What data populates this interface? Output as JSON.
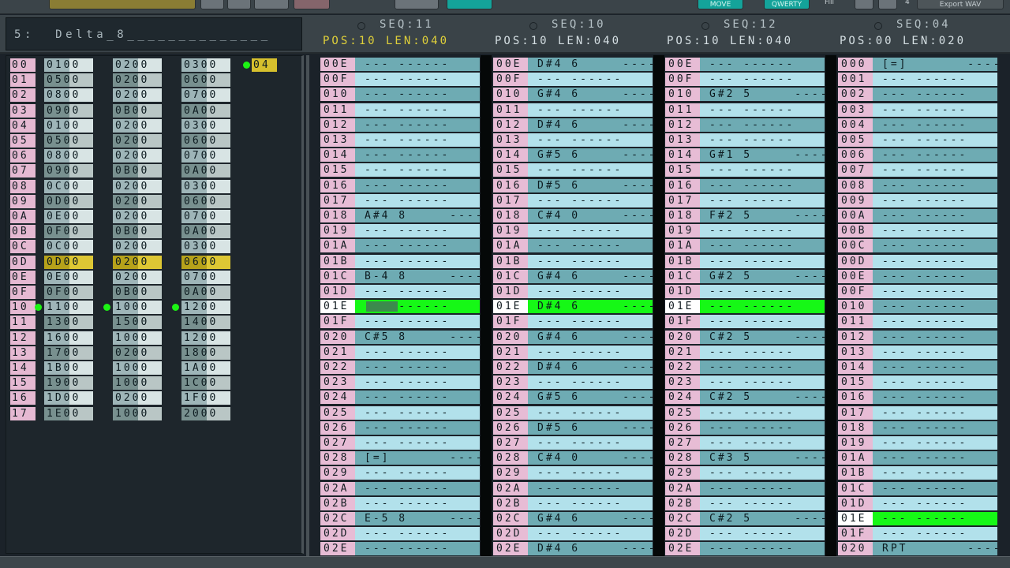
{
  "topbar": {
    "move_label": "MOVE",
    "qwerty_label": "QWERTY",
    "fill_label": "Fill",
    "fill_value": "4",
    "export_label": "Export WAV"
  },
  "song": {
    "slot": "5",
    "name": "Delta_8______________"
  },
  "sequences": [
    {
      "title": "SEQ:11",
      "pos": "10",
      "len": "040",
      "active": true
    },
    {
      "title": "SEQ:10",
      "pos": "10",
      "len": "040",
      "active": false
    },
    {
      "title": "SEQ:12",
      "pos": "10",
      "len": "040",
      "active": false
    },
    {
      "title": "SEQ:04",
      "pos": "00",
      "len": "020",
      "active": false
    }
  ],
  "colors": {
    "accent_yellow": "#dfd03a",
    "cursor_green": "#16f816",
    "row_light": "#b2e1eb",
    "row_dark": "#6eabb3",
    "row_index": "#e7bcd5"
  },
  "order_list": {
    "rows": [
      {
        "idx": "00",
        "c1": "0100",
        "c2": "0200",
        "c3": "0300"
      },
      {
        "idx": "01",
        "c1": "0500",
        "c2": "0200",
        "c3": "0600"
      },
      {
        "idx": "02",
        "c1": "0800",
        "c2": "0200",
        "c3": "0700"
      },
      {
        "idx": "03",
        "c1": "0900",
        "c2": "0B00",
        "c3": "0A00"
      },
      {
        "idx": "04",
        "c1": "0100",
        "c2": "0200",
        "c3": "0300"
      },
      {
        "idx": "05",
        "c1": "0500",
        "c2": "0200",
        "c3": "0600"
      },
      {
        "idx": "06",
        "c1": "0800",
        "c2": "0200",
        "c3": "0700"
      },
      {
        "idx": "07",
        "c1": "0900",
        "c2": "0B00",
        "c3": "0A00"
      },
      {
        "idx": "08",
        "c1": "0C00",
        "c2": "0200",
        "c3": "0300"
      },
      {
        "idx": "09",
        "c1": "0D00",
        "c2": "0200",
        "c3": "0600"
      },
      {
        "idx": "0A",
        "c1": "0E00",
        "c2": "0200",
        "c3": "0700"
      },
      {
        "idx": "0B",
        "c1": "0F00",
        "c2": "0B00",
        "c3": "0A00"
      },
      {
        "idx": "0C",
        "c1": "0C00",
        "c2": "0200",
        "c3": "0300"
      },
      {
        "idx": "0D",
        "c1": "0D00",
        "c2": "0200",
        "c3": "0600"
      },
      {
        "idx": "0E",
        "c1": "0E00",
        "c2": "0200",
        "c3": "0700"
      },
      {
        "idx": "0F",
        "c1": "0F00",
        "c2": "0B00",
        "c3": "0A00"
      },
      {
        "idx": "10",
        "c1": "1100",
        "c2": "1000",
        "c3": "1200"
      },
      {
        "idx": "11",
        "c1": "1300",
        "c2": "1500",
        "c3": "1400"
      },
      {
        "idx": "12",
        "c1": "1600",
        "c2": "1000",
        "c3": "1200"
      },
      {
        "idx": "13",
        "c1": "1700",
        "c2": "0200",
        "c3": "1800"
      },
      {
        "idx": "14",
        "c1": "1B00",
        "c2": "1000",
        "c3": "1A00"
      },
      {
        "idx": "15",
        "c1": "1900",
        "c2": "1000",
        "c3": "1C00"
      },
      {
        "idx": "16",
        "c1": "1D00",
        "c2": "0200",
        "c3": "1F00"
      },
      {
        "idx": "17",
        "c1": "1E00",
        "c2": "1000",
        "c3": "2000"
      }
    ],
    "highlight_row": "0D",
    "playing_row": "10",
    "extra_value": "04"
  },
  "tracks": [
    {
      "rows": [
        "00E",
        "00F",
        "010",
        "011",
        "012",
        "013",
        "014",
        "015",
        "016",
        "017",
        "018",
        "019",
        "01A",
        "01B",
        "01C",
        "01D",
        "01E",
        "01F",
        "020",
        "021",
        "022",
        "023",
        "024",
        "025",
        "026",
        "027",
        "028",
        "029",
        "02A",
        "02B",
        "02C",
        "02D",
        "02E"
      ],
      "notes": {
        "018": "A#4 8",
        "01C": "B-4 8",
        "020": "C#5 8",
        "028": "[=]",
        "02C": "E-5 8"
      }
    },
    {
      "rows": [
        "00E",
        "00F",
        "010",
        "011",
        "012",
        "013",
        "014",
        "015",
        "016",
        "017",
        "018",
        "019",
        "01A",
        "01B",
        "01C",
        "01D",
        "01E",
        "01F",
        "020",
        "021",
        "022",
        "023",
        "024",
        "025",
        "026",
        "027",
        "028",
        "029",
        "02A",
        "02B",
        "02C",
        "02D",
        "02E"
      ],
      "notes": {
        "00E": "D#4 6",
        "010": "G#4 6",
        "012": "D#4 6",
        "014": "G#5 6",
        "016": "D#5 6",
        "018": "C#4 0",
        "01C": "G#4 6",
        "01E": "D#4 6",
        "020": "G#4 6",
        "022": "D#4 6",
        "024": "G#5 6",
        "026": "D#5 6",
        "028": "C#4 0",
        "02C": "G#4 6",
        "02E": "D#4 6"
      }
    },
    {
      "rows": [
        "00E",
        "00F",
        "010",
        "011",
        "012",
        "013",
        "014",
        "015",
        "016",
        "017",
        "018",
        "019",
        "01A",
        "01B",
        "01C",
        "01D",
        "01E",
        "01F",
        "020",
        "021",
        "022",
        "023",
        "024",
        "025",
        "026",
        "027",
        "028",
        "029",
        "02A",
        "02B",
        "02C",
        "02D",
        "02E"
      ],
      "notes": {
        "010": "G#2 5",
        "014": "G#1 5",
        "018": "F#2 5",
        "01C": "G#2 5",
        "020": "C#2 5",
        "024": "C#2 5",
        "028": "C#3 5",
        "02C": "C#2 5"
      }
    },
    {
      "rows": [
        "000",
        "001",
        "002",
        "003",
        "004",
        "005",
        "006",
        "007",
        "008",
        "009",
        "00A",
        "00B",
        "00C",
        "00D",
        "00E",
        "00F",
        "010",
        "011",
        "012",
        "013",
        "014",
        "015",
        "016",
        "017",
        "018",
        "019",
        "01A",
        "01B",
        "01C",
        "01D",
        "01E",
        "01F",
        "020"
      ],
      "notes": {
        "000": "[=]",
        "020": "RPT"
      }
    }
  ]
}
